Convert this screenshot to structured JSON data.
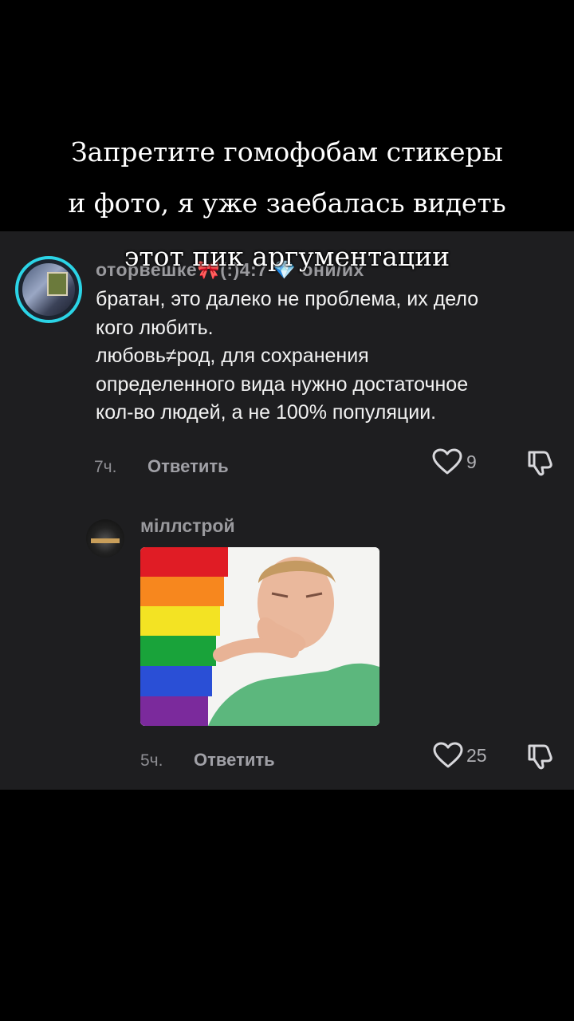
{
  "caption": {
    "line1": "Запретите гомофобам стикеры",
    "line2": "и фото, я уже заебалась видеть",
    "line3": "этот пик аргументации"
  },
  "comment1": {
    "username": "оторвешке🎀(:)4:7 💎 они/их",
    "lines": [
      "братан, это далеко не проблема, их дело",
      "кого любить.",
      "любовь≠род, для сохранения",
      "определенного вида нужно достаточное",
      "кол-во людей, а не 100% популяции."
    ],
    "time": "7ч.",
    "reply_label": "Ответить",
    "likes": "9"
  },
  "comment2": {
    "username": "міллстрой",
    "sticker_icon": "rainbow-flag-reaction-sticker",
    "time": "5ч.",
    "reply_label": "Ответить",
    "likes": "25"
  },
  "colors": {
    "background": "#000000",
    "panel": "#1e1e20",
    "avatar_ring": "#2bd4e6"
  }
}
